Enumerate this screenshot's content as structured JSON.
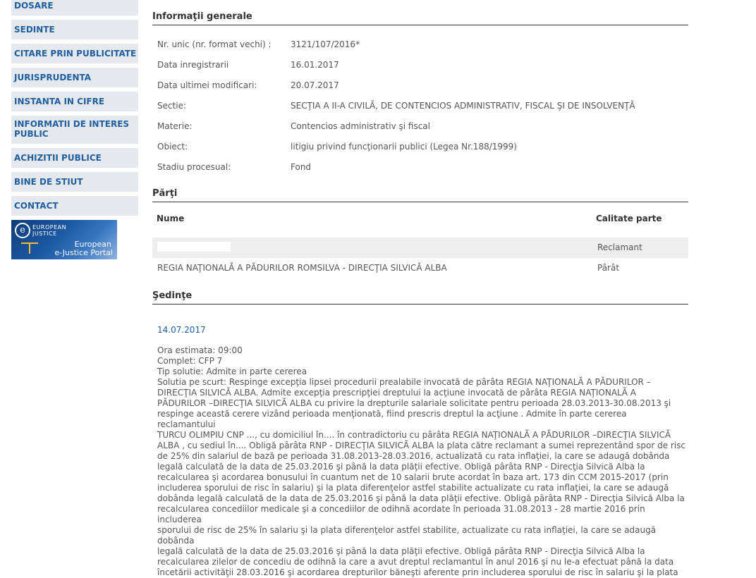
{
  "nav": {
    "items": [
      {
        "label": "DOSARE"
      },
      {
        "label": "SEDINTE"
      },
      {
        "label": "CITARE PRIN PUBLICITATE"
      },
      {
        "label": "JURISPRUDENTA"
      },
      {
        "label": "INSTANTA IN CIFRE"
      },
      {
        "label": "INFORMATII DE INTERES PUBLIC"
      },
      {
        "label": "ACHIZITII PUBLICE"
      },
      {
        "label": "BINE DE STIUT"
      },
      {
        "label": "CONTACT"
      }
    ],
    "banner": {
      "small_line1": "EUROPEAN",
      "small_line2": "JUSTICE",
      "title_line1": "European",
      "title_line2": "e-Justice Portal",
      "logo_letter": "e"
    }
  },
  "info": {
    "title": "Informaţii generale",
    "rows": [
      {
        "label": "Nr. unic (nr. format vechi) :",
        "value": "3121/107/2016*"
      },
      {
        "label": "Data inregistrarii",
        "value": "16.01.2017"
      },
      {
        "label": "Data ultimei modificari:",
        "value": "20.07.2017"
      },
      {
        "label": "Sectie:",
        "value": "SECŢIA A II-A CIVILĂ, DE CONTENCIOS ADMINISTRATIV, FISCAL ŞI DE INSOLVENŢĂ"
      },
      {
        "label": "Materie:",
        "value": "Contencios administrativ şi fiscal"
      },
      {
        "label": "Obiect:",
        "value": "litigiu privind funcţionarii publici (Legea Nr.188/1999)"
      },
      {
        "label": "Stadiu procesual:",
        "value": "Fond"
      }
    ]
  },
  "parti": {
    "title": "Părţi",
    "col_name": "Nume",
    "col_calitate": "Calitate parte",
    "rows": [
      {
        "name": "",
        "calitate": "Reclamant"
      },
      {
        "name": "REGIA NAŢIONALĂ A PĂDURILOR ROMSILVA - DIRECŢIA SILVICĂ ALBA",
        "calitate": "Pârât"
      }
    ]
  },
  "sedinte": {
    "title": "Şedinţe",
    "date": "14.07.2017",
    "lines": [
      "Ora estimata: 09:00",
      "Complet: CFP 7",
      "Tip solutie: Admite in parte cererea",
      "Solutia pe scurt: Respinge excepţia lipsei procedurii prealabile invocată de pârâta REGIA NAŢIONALĂ A PĂDURILOR –",
      "DIRECŢIA SILVICĂ ALBA. Admite excepţia prescripţiei dreptului la acţiune invocată de pârâta REGIA NAŢIONALĂ A",
      "PĂDURILOR –DIRECŢIA SILVICĂ ALBA cu privire la drepturile salariale solicitate pentru perioada 28.03.2013-30.08.2013 şi",
      "respinge această cerere vizând perioada menţionată, fiind prescris dreptul la acţiune . Admite în parte cererea reclamantului",
      "TURCU OLIMPIU CNP ..., cu domiciliul în.... în contradictoriu cu pârâta REGIA NAŢIONALĂ A PĂDURILOR –DIRECŢIA SILVICĂ",
      "ALBA , cu sediul în.... Obligă pârâta RNP - DIRECŢIA SILVICĂ ALBA la plata către reclamant a sumei reprezentând spor de risc",
      "de 25% din salariul de bază pe perioada 31.08.2013-28.03.2016, actualizată cu rata inflaţiei, la care se adaugă dobânda",
      "legală calculată de la data de 25.03.2016 şi până la data plăţii efective. Obligă pârâta RNP - Direcţia Silvică Alba la",
      "recalcularea şi acordarea bonusului în cuantum net de 10 salarii brute acordat în baza art. 173 din CCM 2015-2017 (prin",
      "includerea sporului de risc în salariu) şi la plata diferenţelor astfel stabilite actualizate cu rata inflaţiei, la care se adaugă",
      "dobânda legală calculată de la data de 25.03.2016 şi până la data plăţii efective. Obligă pârâta RNP - Direcţia Silvică Alba la",
      "recalcularea concediilor medicale şi a concediilor de odihnă acordate în perioada 31.08.2013 - 28 martie 2016 prin includerea",
      "sporului de risc de 25% în salariu şi la plata diferenţelor astfel stabilite, actualizate cu rata inflaţiei, la care se adaugă dobânda",
      "legală calculată de la data de 25.03.2016 şi până la data plăţii efective. Obligă pârâta RNP - Direcţia Silvică Alba la",
      "recalcularea zilelor de concediu de odihnă la care a avut dreptul reclamantul în anul 2016 şi nu le-a efectuat până la data",
      "încetării activităţii 28.03.2016 şi acordarea drepturilor băneşti aferente prin includerea sporului de risc în salariu şi la plata"
    ]
  }
}
